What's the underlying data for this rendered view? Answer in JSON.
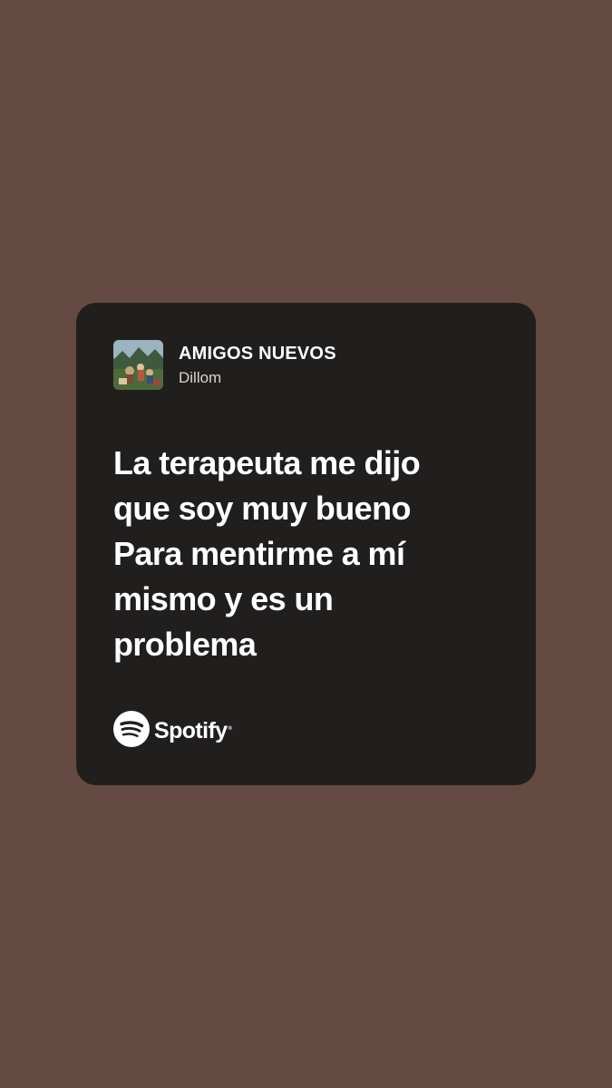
{
  "page": {
    "background_color": "#644a40",
    "card_color": "#211e1e"
  },
  "track": {
    "title": "AMIGOS NUEVOS",
    "artist": "Dillom",
    "cover_icon": "album-cover-image"
  },
  "lyrics": {
    "lines": [
      "La terapeuta me dijo",
      "que soy muy bueno",
      "Para mentirme a mí",
      "mismo y es un",
      "problema"
    ]
  },
  "brand": {
    "icon": "spotify-logo-icon",
    "name": "Spotify"
  }
}
